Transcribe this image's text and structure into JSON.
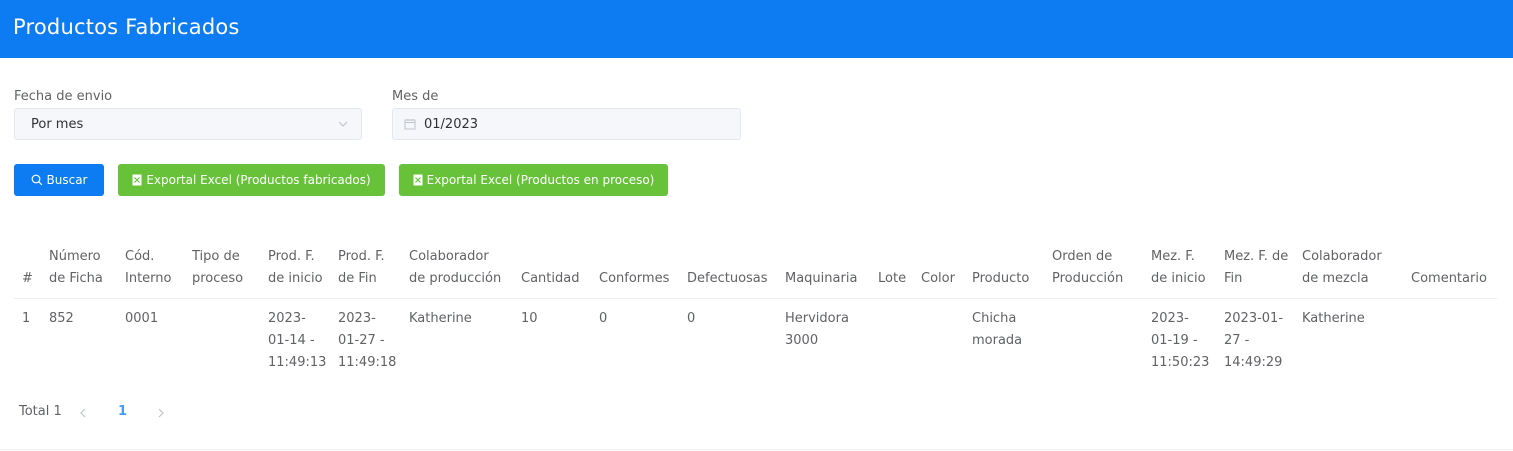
{
  "header": {
    "title": "Productos Fabricados"
  },
  "filters": {
    "fecha_label": "Fecha de envio",
    "fecha_value": "Por mes",
    "mes_label": "Mes de",
    "mes_value": "01/2023"
  },
  "buttons": {
    "buscar": "Buscar",
    "export_fabricados": "Exportal Excel (Productos fabricados)",
    "export_proceso": "Exportal Excel (Productos en proceso)"
  },
  "table": {
    "columns": [
      "#",
      "Número de Ficha",
      "Cód. Interno",
      "Tipo de proceso",
      "Prod. F. de inicio",
      "Prod. F. de Fin",
      "Colaborador de producción",
      "Cantidad",
      "Conformes",
      "Defectuosas",
      "Maquinaria",
      "Lote",
      "Color",
      "Producto",
      "Orden de Producción",
      "Mez. F. de inicio",
      "Mez. F. de Fin",
      "Colaborador de mezcla",
      "Comentario"
    ],
    "rows": [
      {
        "num": "1",
        "ficha": "852",
        "cod": "0001",
        "tipo": "",
        "prod_inicio": "2023-01-14 - 11:49:13",
        "prod_fin": "2023-01-27 - 11:49:18",
        "colab_prod": "Katherine",
        "cantidad": "10",
        "conformes": "0",
        "defectuosas": "0",
        "maquinaria": "Hervidora 3000",
        "lote": "",
        "color": "",
        "producto": "Chicha morada",
        "orden": "",
        "mez_inicio": "2023-01-19 - 11:50:23",
        "mez_fin": "2023-01-27 - 14:49:29",
        "colab_mezcla": "Katherine",
        "comentario": ""
      }
    ]
  },
  "pagination": {
    "total": "Total 1",
    "current": "1"
  },
  "icons": {
    "select": "chevron-down-icon",
    "date": "calendar-icon",
    "search": "search-icon",
    "excel": "excel-icon",
    "prev": "chevron-left-icon",
    "next": "chevron-right-icon"
  },
  "colors": {
    "primary": "#0d7bf2",
    "success": "#67c23a",
    "active_page": "#409eff"
  }
}
